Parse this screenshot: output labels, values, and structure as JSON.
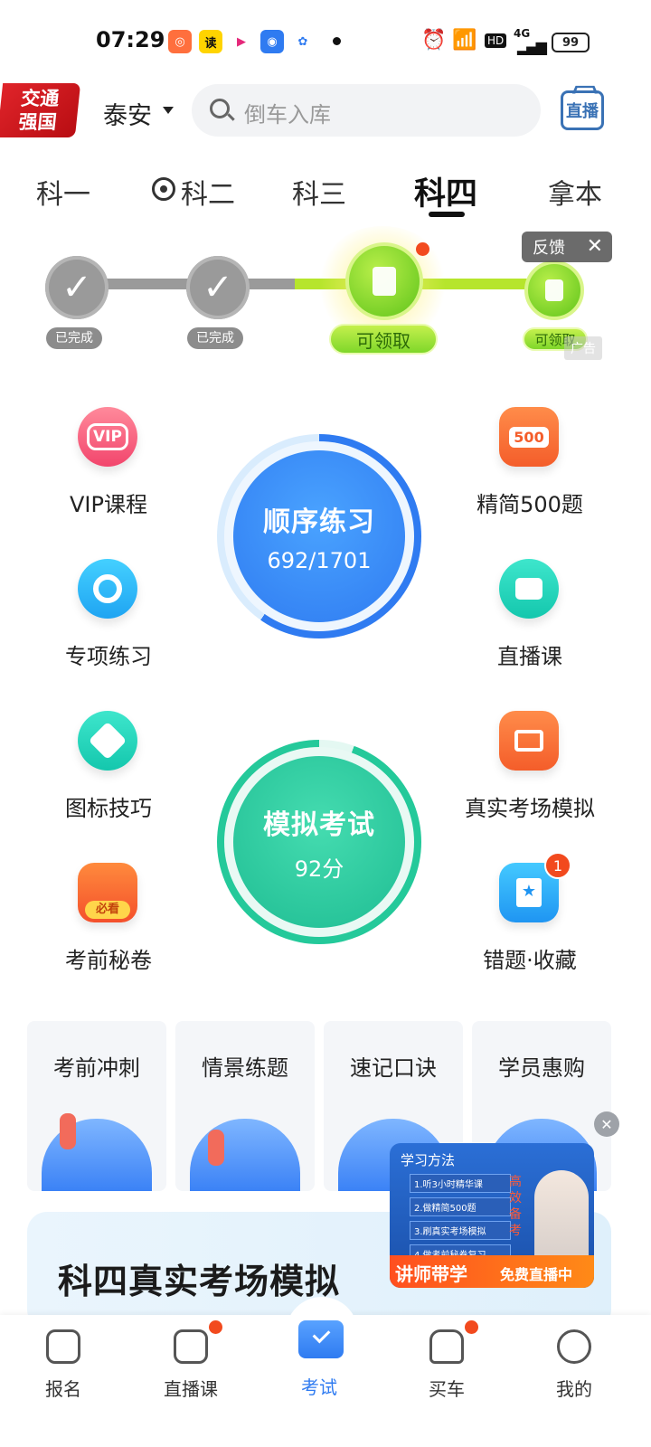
{
  "status_bar": {
    "time": "07:29",
    "apps": [
      "album-app-icon",
      "read-app-icon",
      "video-app-icon",
      "assistant-app-icon",
      "baidu-app-icon"
    ],
    "hd": "HD",
    "network": "4G",
    "battery": "99"
  },
  "header": {
    "logo_line1": "交通",
    "logo_line2": "强国",
    "city": "泰安",
    "search_placeholder": "倒车入库",
    "live_button": "直播"
  },
  "subject_tabs": [
    "科一",
    "科二",
    "科三",
    "科四",
    "拿本"
  ],
  "active_tab": "科四",
  "progress": {
    "step1": "已完成",
    "step2": "已完成",
    "step3": "可领取",
    "step4": "可领取",
    "feedback": "反馈",
    "ad": "广告"
  },
  "features": {
    "vip": "VIP课程",
    "vip_icon_text": "VIP",
    "special": "专项练习",
    "sign": "图标技巧",
    "secret": "考前秘卷",
    "secret_icon_text": "必看",
    "simple500": "精简500题",
    "simple500_icon_text": "500",
    "live_course": "直播课",
    "real_exam": "真实考场模拟",
    "wrong": "错题·收藏",
    "wrong_badge": "1"
  },
  "sequence_practice": {
    "title": "顺序练习",
    "progress": "692/1701"
  },
  "mock_exam": {
    "title": "模拟考试",
    "score": "92分"
  },
  "cards": [
    "考前冲刺",
    "情景练题",
    "速记口诀",
    "学员惠购"
  ],
  "banner": {
    "title": "科四真实考场模拟"
  },
  "float_ad": {
    "heading": "学习方法",
    "items": [
      "1.听3小时精华课",
      "2.做精简500题",
      "3.刷真实考场模拟",
      "4.做考前秘卷复习"
    ],
    "side_text": "高效备考",
    "cta_left": "讲师带学",
    "cta_right": "免费直播中"
  },
  "bottom_nav": {
    "signup": "报名",
    "live": "直播课",
    "exam": "考试",
    "buy_car": "买车",
    "mine": "我的"
  },
  "colors": {
    "accent_blue": "#2f7bf1",
    "green": "#24c99a",
    "orange": "#ff6a3d",
    "badge_red": "#f24a1e"
  }
}
